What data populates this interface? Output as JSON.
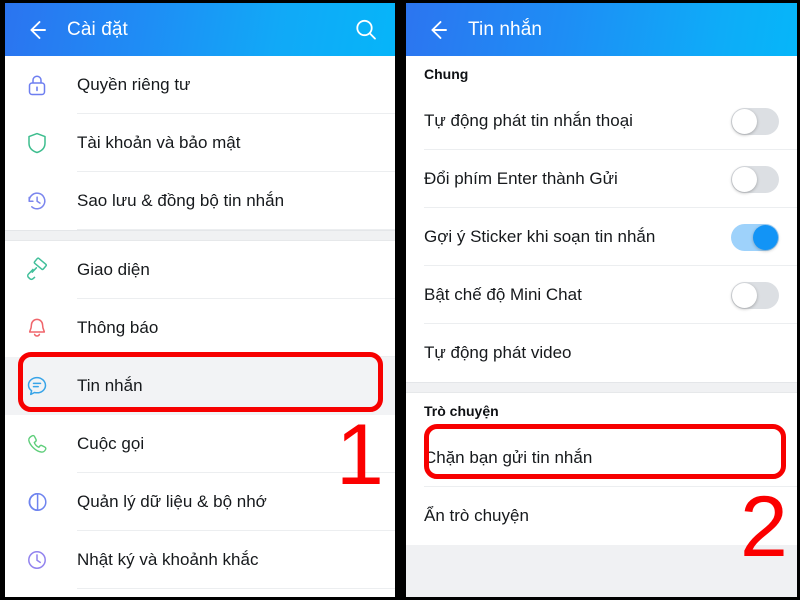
{
  "annotations": {
    "highlight_color": "#f70000",
    "step_one": "1",
    "step_two": "2"
  },
  "left_panel": {
    "header": {
      "back_icon": "back-arrow-icon",
      "title": "Cài đặt",
      "search_icon": "search-icon"
    },
    "groups": [
      {
        "items": [
          {
            "label": "Quyền riêng tư",
            "icon": "lock-icon",
            "icon_color": "#6d7ef0",
            "selected": false
          },
          {
            "label": "Tài khoản và bảo mật",
            "icon": "shield-icon",
            "icon_color": "#3dbd8e",
            "selected": false
          },
          {
            "label": "Sao lưu & đồng bộ tin nhắn",
            "icon": "history-clock-icon",
            "icon_color": "#7b86ee",
            "selected": false
          }
        ]
      },
      {
        "items": [
          {
            "label": "Giao diện",
            "icon": "paint-roller-icon",
            "icon_color": "#41bf9a",
            "selected": false
          },
          {
            "label": "Thông báo",
            "icon": "bell-icon",
            "icon_color": "#f0656b",
            "selected": false
          },
          {
            "label": "Tin nhắn",
            "icon": "chat-bubble-icon",
            "icon_color": "#38a4e8",
            "selected": true
          },
          {
            "label": "Cuộc gọi",
            "icon": "phone-icon",
            "icon_color": "#5fce7b",
            "selected": false
          },
          {
            "label": "Quản lý dữ liệu & bộ nhớ",
            "icon": "pie-chart-icon",
            "icon_color": "#6f84ef",
            "selected": false
          },
          {
            "label": "Nhật ký và khoảnh khắc",
            "icon": "clock-icon",
            "icon_color": "#9283ee",
            "selected": false
          }
        ]
      }
    ]
  },
  "right_panel": {
    "header": {
      "back_icon": "back-arrow-icon",
      "title": "Tin nhắn"
    },
    "sections": [
      {
        "title": "Chung",
        "rows": [
          {
            "label": "Tự động phát tin nhắn thoại",
            "toggle": "off"
          },
          {
            "label": "Đổi phím Enter thành Gửi",
            "toggle": "off"
          },
          {
            "label": "Gợi ý Sticker khi soạn tin nhắn",
            "toggle": "on"
          },
          {
            "label": "Bật chế độ Mini Chat",
            "toggle": "off"
          },
          {
            "label": "Tự động phát video",
            "toggle": "none"
          }
        ]
      },
      {
        "title": "Trò chuyện",
        "rows": [
          {
            "label": "Chặn bạn gửi tin nhắn",
            "toggle": "none"
          },
          {
            "label": "Ẩn trò chuyện",
            "toggle": "none"
          }
        ]
      }
    ]
  }
}
